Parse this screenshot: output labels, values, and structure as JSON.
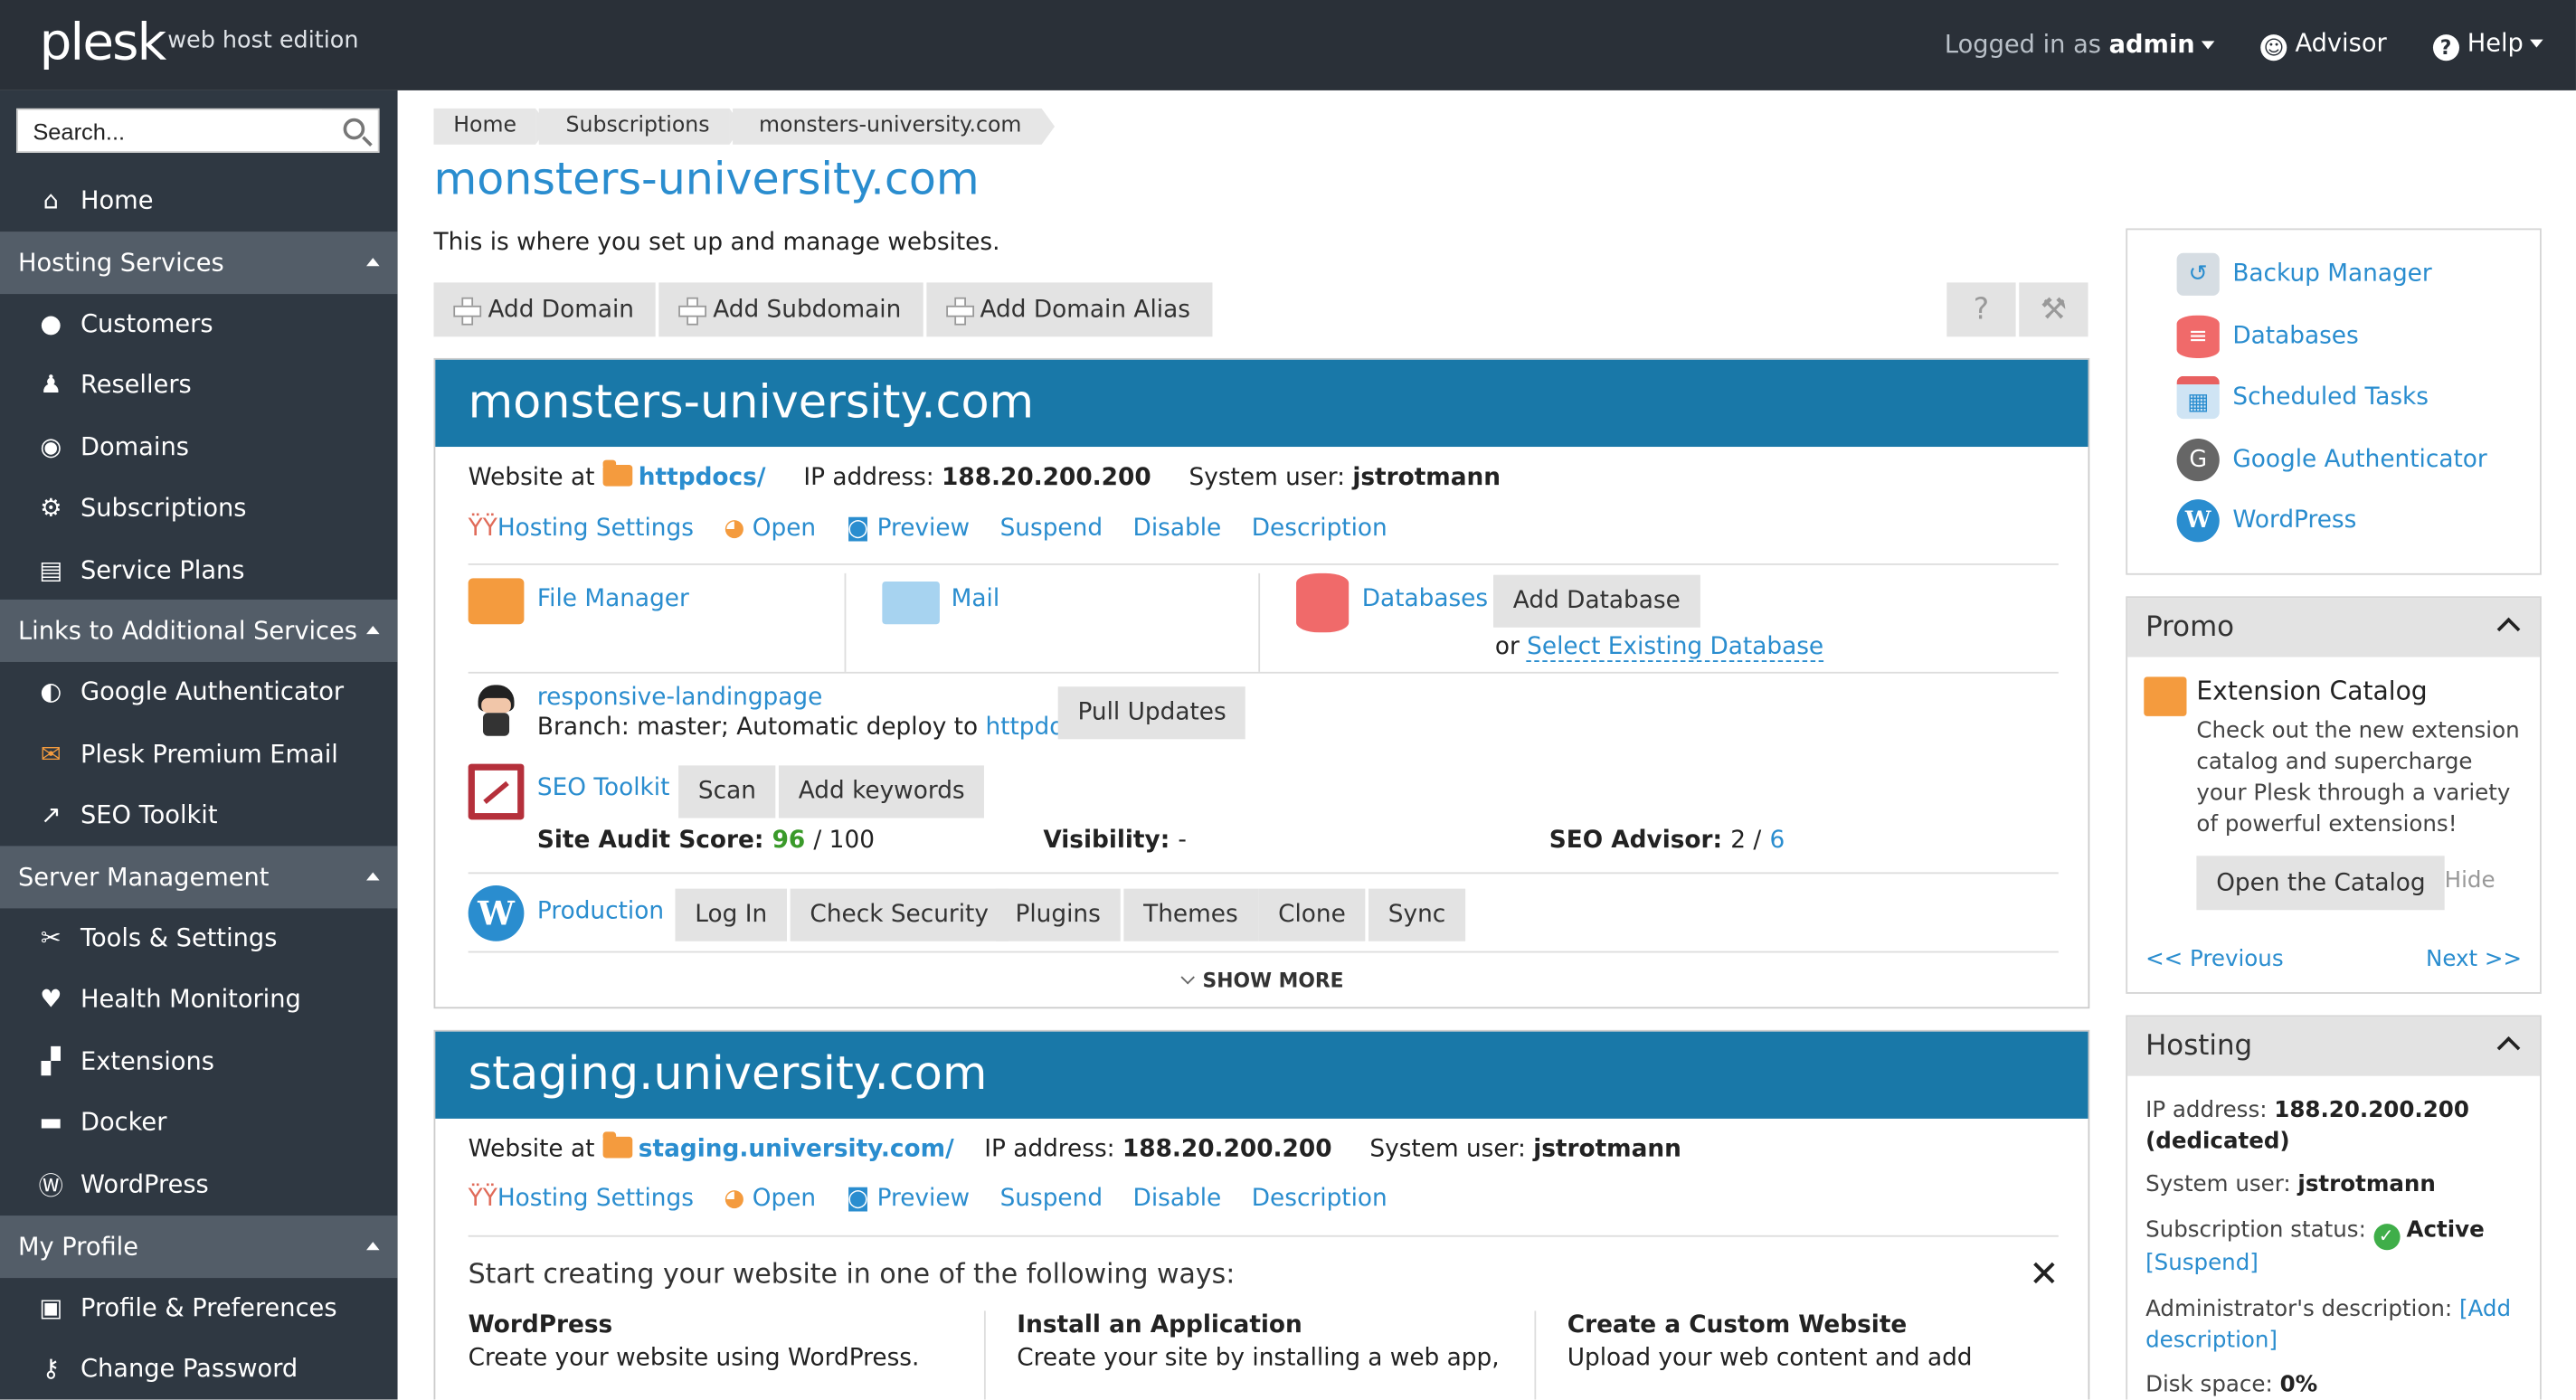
{
  "topbar": {
    "logo": "plesk",
    "edition": "web host edition",
    "logged_in_prefix": "Logged in as",
    "user": "admin",
    "advisor": "Advisor",
    "help": "Help"
  },
  "sidebar": {
    "search_placeholder": "Search...",
    "home": "Home",
    "sections": [
      {
        "title": "Hosting Services",
        "items": [
          "Customers",
          "Resellers",
          "Domains",
          "Subscriptions",
          "Service Plans"
        ]
      },
      {
        "title": "Links to Additional Services",
        "items": [
          "Google Authenticator",
          "Plesk Premium Email",
          "SEO Toolkit"
        ]
      },
      {
        "title": "Server Management",
        "items": [
          "Tools & Settings",
          "Health Monitoring",
          "Extensions",
          "Docker",
          "WordPress"
        ]
      },
      {
        "title": "My Profile",
        "items": [
          "Profile & Preferences",
          "Change Password"
        ]
      }
    ]
  },
  "breadcrumb": [
    "Home",
    "Subscriptions",
    "monsters-university.com"
  ],
  "page": {
    "title": "monsters-university.com",
    "description": "This is where you set up and manage websites."
  },
  "toolbar": {
    "add_domain": "Add Domain",
    "add_subdomain": "Add Subdomain",
    "add_alias": "Add Domain Alias"
  },
  "domain1": {
    "name": "monsters-university.com",
    "website_at": "Website at",
    "docroot": "httpdocs/",
    "ip_label": "IP address:",
    "ip": "188.20.200.200",
    "sysuser_label": "System user:",
    "sysuser": "jstrotmann",
    "actions": [
      "Hosting Settings",
      "Open",
      "Preview",
      "Suspend",
      "Disable",
      "Description"
    ],
    "file_manager": "File Manager",
    "mail": "Mail",
    "databases": "Databases",
    "add_database": "Add Database",
    "or": "or",
    "select_db": "Select Existing Database",
    "git_repo": "responsive-landingpage",
    "git_branch": "Branch: master; Automatic deploy to",
    "git_target": "httpdocs",
    "pull_updates": "Pull Updates",
    "seo": "SEO Toolkit",
    "scan": "Scan",
    "add_keywords": "Add keywords",
    "audit_label": "Site Audit Score:",
    "audit_score": "96",
    "audit_total": "/ 100",
    "visibility_label": "Visibility:",
    "visibility": "-",
    "advisor_label": "SEO Advisor:",
    "advisor_a": "2 /",
    "advisor_b": "6",
    "wp_name": "Production",
    "wp_buttons": [
      "Log In",
      "Check Security",
      "Plugins",
      "Themes",
      "Clone",
      "Sync"
    ],
    "show_more": "SHOW MORE"
  },
  "domain2": {
    "name": "staging.university.com",
    "website_at": "Website at",
    "docroot": "staging.university.com/",
    "ip_label": "IP address:",
    "ip": "188.20.200.200",
    "sysuser_label": "System user:",
    "sysuser": "jstrotmann",
    "actions": [
      "Hosting Settings",
      "Open",
      "Preview",
      "Suspend",
      "Disable",
      "Description"
    ],
    "start_text": "Start creating your website in one of the following ways:",
    "options": [
      {
        "title": "WordPress",
        "desc": "Create your website using WordPress."
      },
      {
        "title": "Install an Application",
        "desc": "Create your site by installing a web app,"
      },
      {
        "title": "Create a Custom Website",
        "desc": "Upload your web content and add"
      }
    ]
  },
  "right": {
    "tools": [
      "Backup Manager",
      "Databases",
      "Scheduled Tasks",
      "Google Authenticator",
      "WordPress"
    ],
    "promo": {
      "title": "Promo",
      "heading": "Extension Catalog",
      "body": "Check out the new extension catalog and supercharge your Plesk through a variety of powerful extensions!",
      "button": "Open the Catalog",
      "hide": "Hide",
      "prev": "<< Previous",
      "next": "Next >>"
    },
    "hosting": {
      "title": "Hosting",
      "ip_label": "IP address:",
      "ip": "188.20.200.200 (dedicated)",
      "sysuser_label": "System user:",
      "sysuser": "jstrotmann",
      "status_label": "Subscription status:",
      "status": "Active",
      "suspend": "[Suspend]",
      "admin_desc_label": "Administrator's description:",
      "admin_desc_link": "[Add description]",
      "disk_label": "Disk space:",
      "disk": "0%"
    }
  },
  "colors": {
    "topbar": "#2a3038",
    "sidebar": "#2f3842",
    "section": "#535d68",
    "accent": "#2a8dcf",
    "card_header": "#1978a8"
  }
}
